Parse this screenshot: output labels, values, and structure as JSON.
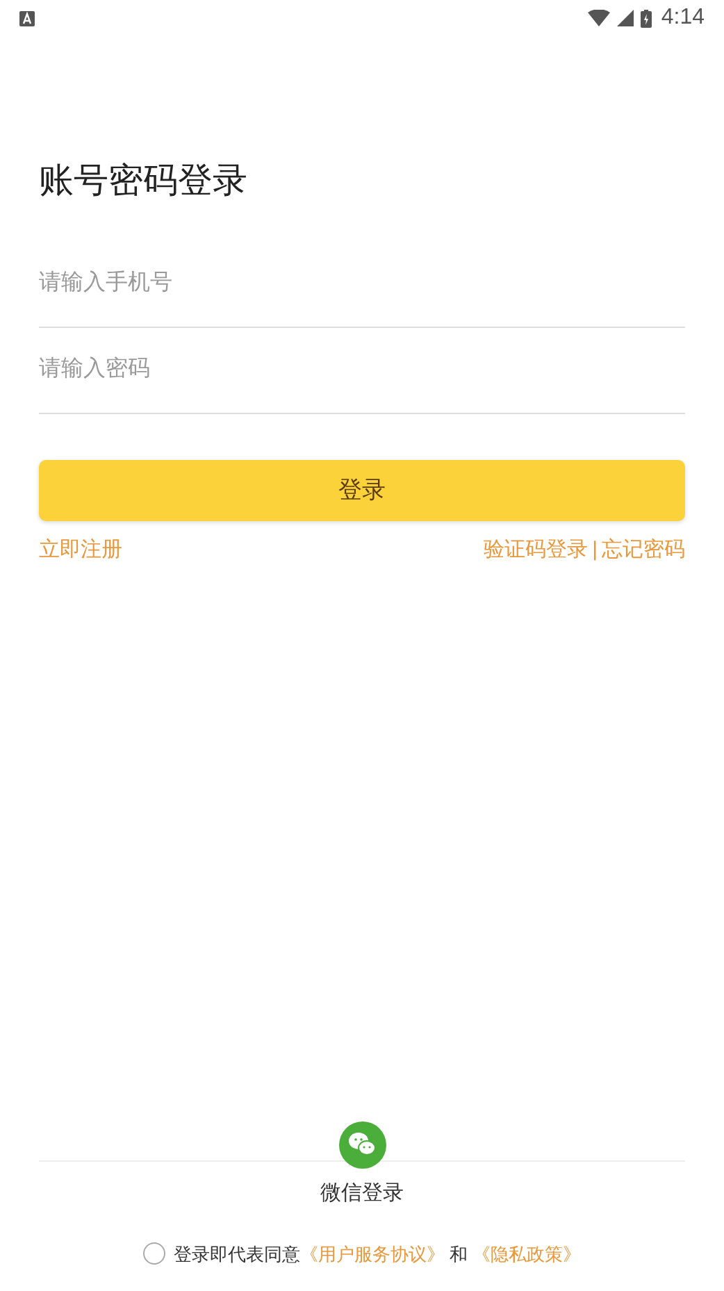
{
  "status_bar": {
    "time": "4:14"
  },
  "title": "账号密码登录",
  "fields": [
    {
      "placeholder": "请输入手机号"
    },
    {
      "placeholder": "请输入密码"
    }
  ],
  "login_button": "登录",
  "links": {
    "register": "立即注册",
    "sms_login": "验证码登录",
    "separator": "|",
    "forgot": "忘记密码"
  },
  "wechat_login": "微信登录",
  "agreement": {
    "checked": false,
    "text": "登录即代表同意",
    "terms": "《用户服务协议》",
    "and": "和",
    "privacy": "《隐私政策》"
  }
}
